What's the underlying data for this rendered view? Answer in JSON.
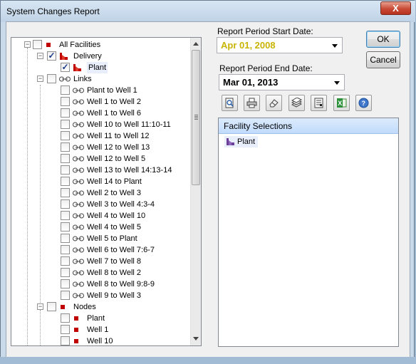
{
  "window": {
    "title": "System Changes Report",
    "close_label": "X"
  },
  "tree": {
    "rows": [
      {
        "label": "All Facilities",
        "level": 0,
        "expander": "minus",
        "checked": false,
        "icon": "node-square-icon"
      },
      {
        "label": "Delivery",
        "level": 1,
        "expander": "minus",
        "checked": true,
        "icon": "facility-icon"
      },
      {
        "label": "Plant",
        "level": 2,
        "expander": "",
        "checked": true,
        "icon": "facility-icon",
        "selected": true
      },
      {
        "label": "Links",
        "level": 1,
        "expander": "minus",
        "checked": false,
        "icon": "link-icon"
      },
      {
        "label": "Plant to Well 1",
        "level": 2,
        "expander": "",
        "checked": false,
        "icon": "link-icon"
      },
      {
        "label": "Well 1 to Well 2",
        "level": 2,
        "expander": "",
        "checked": false,
        "icon": "link-icon"
      },
      {
        "label": "Well 1 to Well 6",
        "level": 2,
        "expander": "",
        "checked": false,
        "icon": "link-icon"
      },
      {
        "label": "Well 10 to Well 11:10-11",
        "level": 2,
        "expander": "",
        "checked": false,
        "icon": "link-icon"
      },
      {
        "label": "Well 11 to Well 12",
        "level": 2,
        "expander": "",
        "checked": false,
        "icon": "link-icon"
      },
      {
        "label": "Well 12 to Well 13",
        "level": 2,
        "expander": "",
        "checked": false,
        "icon": "link-icon"
      },
      {
        "label": "Well 12 to Well 5",
        "level": 2,
        "expander": "",
        "checked": false,
        "icon": "link-icon"
      },
      {
        "label": "Well 13 to Well 14:13-14",
        "level": 2,
        "expander": "",
        "checked": false,
        "icon": "link-icon"
      },
      {
        "label": "Well 14 to Plant",
        "level": 2,
        "expander": "",
        "checked": false,
        "icon": "link-icon"
      },
      {
        "label": "Well 2 to Well 3",
        "level": 2,
        "expander": "",
        "checked": false,
        "icon": "link-icon"
      },
      {
        "label": "Well 3 to Well 4:3-4",
        "level": 2,
        "expander": "",
        "checked": false,
        "icon": "link-icon"
      },
      {
        "label": "Well 4 to Well 10",
        "level": 2,
        "expander": "",
        "checked": false,
        "icon": "link-icon"
      },
      {
        "label": "Well 4 to Well 5",
        "level": 2,
        "expander": "",
        "checked": false,
        "icon": "link-icon"
      },
      {
        "label": "Well 5 to Plant",
        "level": 2,
        "expander": "",
        "checked": false,
        "icon": "link-icon"
      },
      {
        "label": "Well 6 to Well 7:6-7",
        "level": 2,
        "expander": "",
        "checked": false,
        "icon": "link-icon"
      },
      {
        "label": "Well 7 to Well 8",
        "level": 2,
        "expander": "",
        "checked": false,
        "icon": "link-icon"
      },
      {
        "label": "Well 8 to Well 2",
        "level": 2,
        "expander": "",
        "checked": false,
        "icon": "link-icon"
      },
      {
        "label": "Well 8 to Well 9:8-9",
        "level": 2,
        "expander": "",
        "checked": false,
        "icon": "link-icon"
      },
      {
        "label": "Well 9 to Well 3",
        "level": 2,
        "expander": "",
        "checked": false,
        "icon": "link-icon"
      },
      {
        "label": "Nodes",
        "level": 1,
        "expander": "minus",
        "checked": false,
        "icon": "node-square-icon"
      },
      {
        "label": "Plant",
        "level": 2,
        "expander": "",
        "checked": false,
        "icon": "node-square-icon"
      },
      {
        "label": "Well 1",
        "level": 2,
        "expander": "",
        "checked": false,
        "icon": "node-square-icon"
      },
      {
        "label": "Well 10",
        "level": 2,
        "expander": "",
        "checked": false,
        "icon": "node-square-icon"
      }
    ]
  },
  "start_date": {
    "label": "Report Period Start Date:",
    "value": "Apr  01, 2008",
    "color": "#c8b400"
  },
  "end_date": {
    "label": "Report Period End Date:",
    "value": "Mar 01, 2013"
  },
  "buttons": {
    "ok": "OK",
    "cancel": "Cancel"
  },
  "toolbar": [
    {
      "name": "preview-icon"
    },
    {
      "name": "print-icon"
    },
    {
      "name": "eraser-icon"
    },
    {
      "name": "layers-icon"
    },
    {
      "name": "report-icon"
    },
    {
      "name": "excel-icon"
    },
    {
      "name": "help-icon"
    }
  ],
  "facility_panel": {
    "header": "Facility Selections",
    "items": [
      {
        "label": "Plant",
        "icon": "facility-icon"
      }
    ]
  }
}
